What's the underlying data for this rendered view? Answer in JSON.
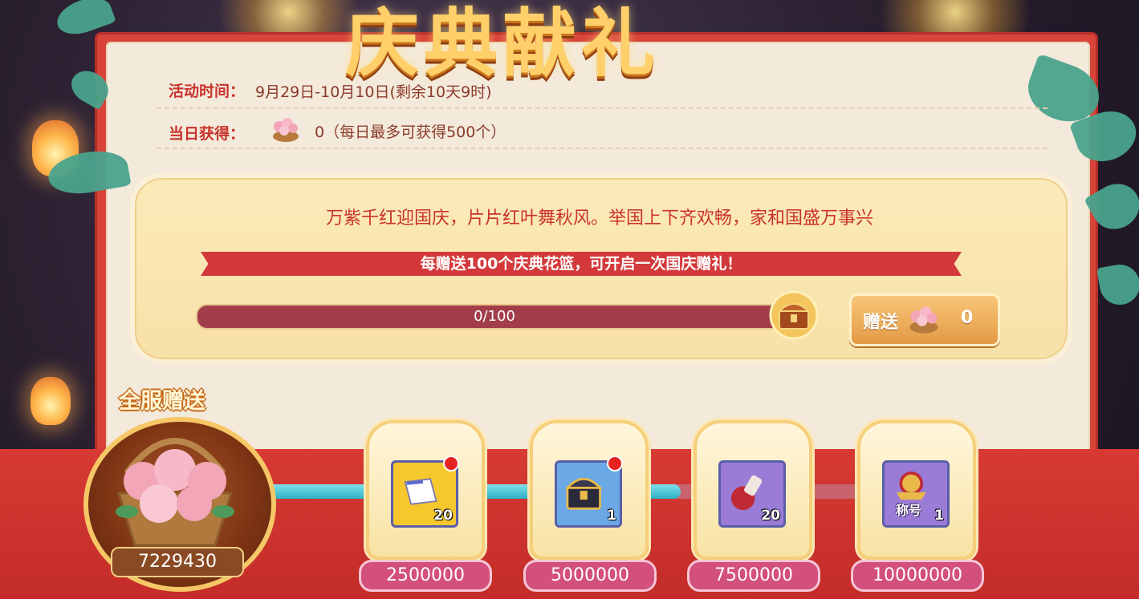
{
  "title": "庆典献礼",
  "event": {
    "time_label": "活动时间：",
    "time_value": "9月29日-10月10日(剩余10天9时)",
    "daily_label": "当日获得：",
    "daily_value": "0（每日最多可获得500个）"
  },
  "panel": {
    "motto": "万紫千红迎国庆，片片红叶舞秋风。举国上下齐欢畅，家和国盛万事兴",
    "ribbon_text": "每赠送100个庆典花篮，可开启一次国庆赠礼！",
    "progress_text": "0/100",
    "progress_fraction": 0,
    "give_button_label": "赠送",
    "give_count": "0"
  },
  "global": {
    "label": "全服赠送",
    "total": "7229430",
    "track_progress_fraction": 0.6
  },
  "rewards": [
    {
      "icon": "scroll-icon",
      "qty": "20",
      "threshold": "2500000",
      "has_notice": true,
      "color": "#f7c82e"
    },
    {
      "icon": "treasure-chest-icon",
      "qty": "1",
      "threshold": "5000000",
      "has_notice": true,
      "color": "#6aa8e6"
    },
    {
      "icon": "potion-icon",
      "qty": "20",
      "threshold": "7500000",
      "has_notice": false,
      "color": "#9a7bd6"
    },
    {
      "icon": "title-badge-icon",
      "qty": "1",
      "threshold": "10000000",
      "has_notice": false,
      "color": "#9a7bd6",
      "badge_text": "称号"
    }
  ]
}
